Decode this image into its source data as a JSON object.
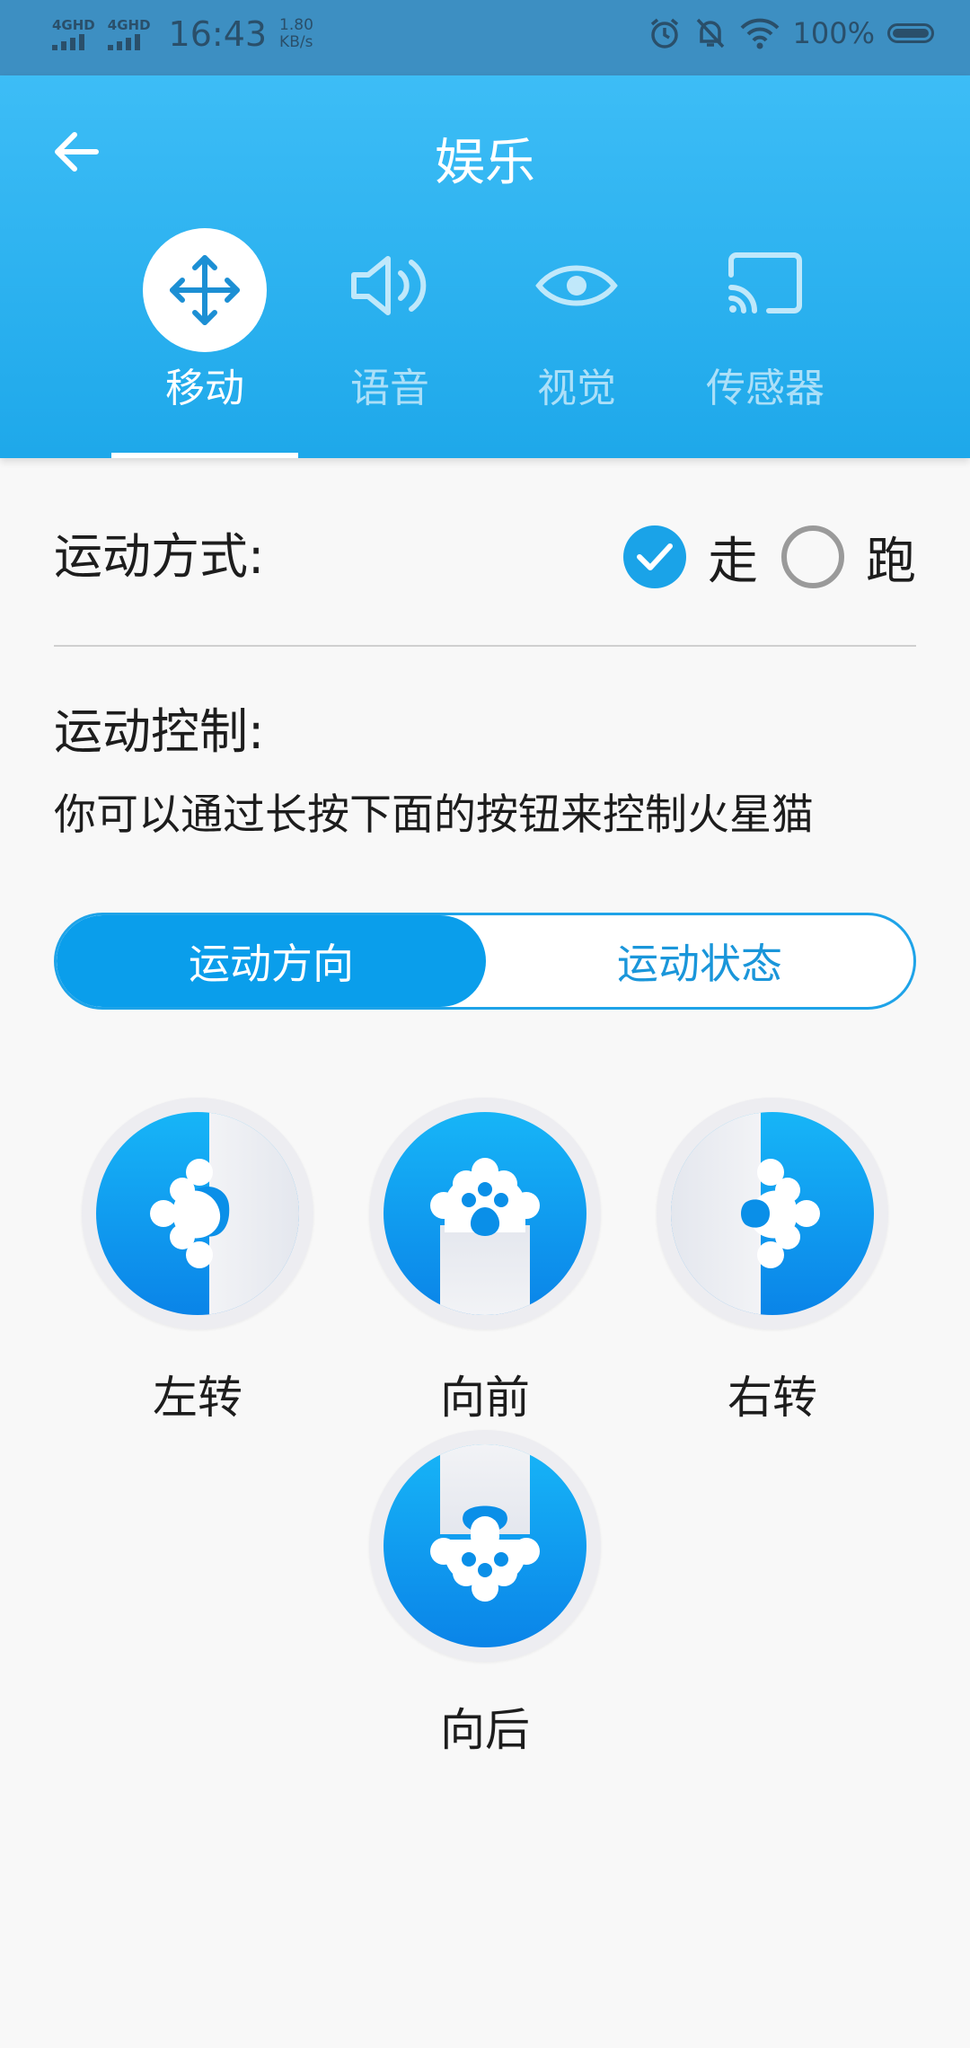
{
  "status_bar": {
    "network1": "4GHD",
    "network2": "4GHD",
    "time": "16:43",
    "speed_value": "1.80",
    "speed_unit": "KB/s",
    "battery": "100%"
  },
  "header": {
    "title": "娱乐",
    "tabs": [
      {
        "label": "移动",
        "icon": "move-icon",
        "active": true
      },
      {
        "label": "语音",
        "icon": "speaker-icon",
        "active": false
      },
      {
        "label": "视觉",
        "icon": "eye-icon",
        "active": false
      },
      {
        "label": "传感器",
        "icon": "cast-icon",
        "active": false
      }
    ]
  },
  "content": {
    "mode_label": "运动方式:",
    "mode_options": [
      {
        "label": "走",
        "selected": true
      },
      {
        "label": "跑",
        "selected": false
      }
    ],
    "control_title": "运动控制:",
    "control_desc": "你可以通过长按下面的按钮来控制火星猫",
    "segment": [
      {
        "label": "运动方向",
        "selected": true
      },
      {
        "label": "运动状态",
        "selected": false
      }
    ],
    "buttons": [
      {
        "label": "左转",
        "icon": "paw-left-icon"
      },
      {
        "label": "向前",
        "icon": "paw-forward-icon"
      },
      {
        "label": "右转",
        "icon": "paw-right-icon"
      },
      {
        "label": "向后",
        "icon": "paw-back-icon"
      }
    ]
  },
  "colors": {
    "header": "#1ea8ea",
    "accent": "#0a9eeb",
    "status_bar": "#3d8fc2"
  }
}
